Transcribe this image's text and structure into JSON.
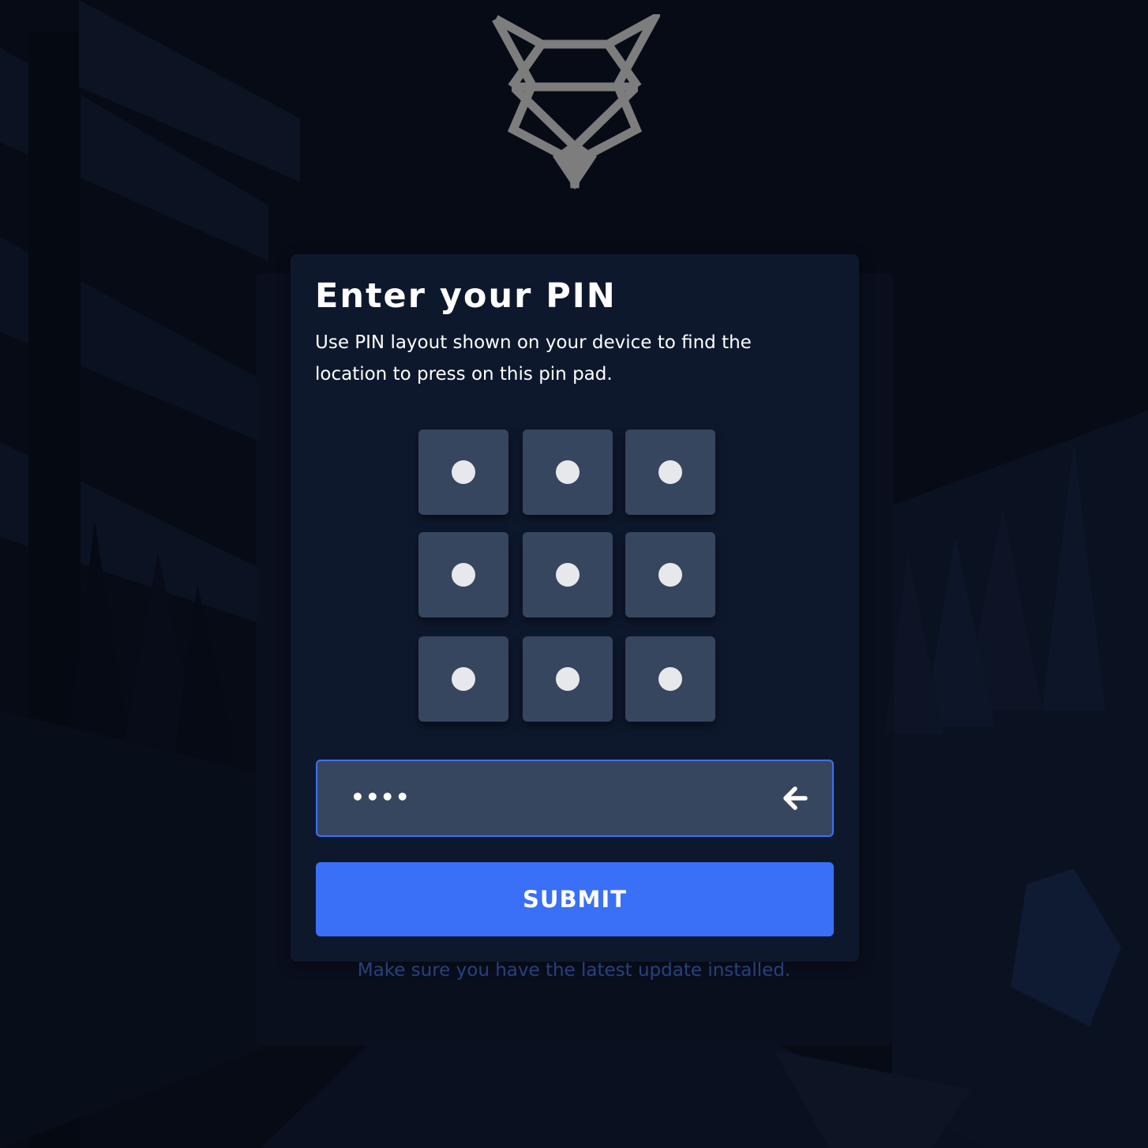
{
  "brand": {
    "logo_icon": "fox-head-logo-icon",
    "logo_color": "#7d7d7d"
  },
  "pin_dialog": {
    "title": "Enter your PIN",
    "description": "Use PIN layout shown on your device to find the location to press on this pin pad.",
    "pin_pad": {
      "rows": 3,
      "columns": 3,
      "key_icon": "dot-icon"
    },
    "pin_field": {
      "value": "••••",
      "backspace_icon": "arrow-left-icon"
    },
    "submit_label": "SUBMIT"
  },
  "footer": {
    "update_notice": "Make sure you have the latest update installed."
  },
  "colors": {
    "background": "#070b16",
    "card": "#0e182d",
    "key": "#37465f",
    "accent": "#3a6ff7",
    "notice": "#27417f"
  }
}
